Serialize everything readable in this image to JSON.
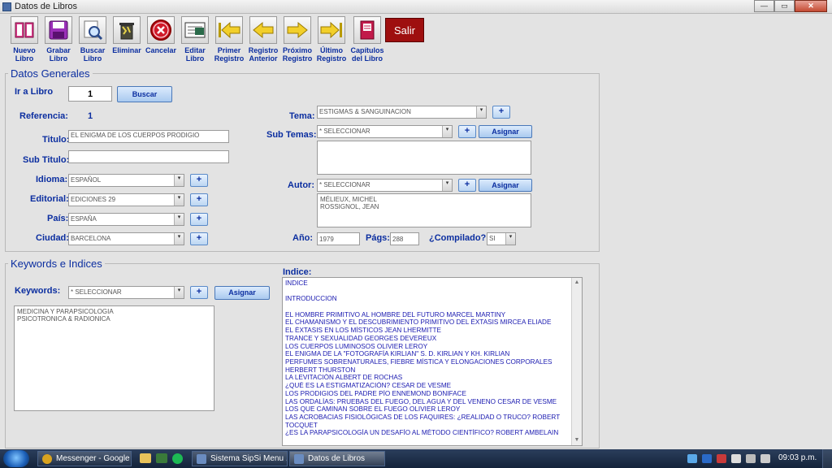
{
  "window": {
    "title": "Datos de Libros",
    "min": "—",
    "max": "▭",
    "close": "✕"
  },
  "toolbar": {
    "buttons": [
      {
        "label": "Nuevo\nLibro",
        "icon": "new-book-icon"
      },
      {
        "label": "Grabar\nLibro",
        "icon": "save-disk-icon"
      },
      {
        "label": "Buscar\nLibro",
        "icon": "search-magnifier-icon"
      },
      {
        "label": "Eliminar",
        "icon": "trash-icon"
      },
      {
        "label": "Cancelar",
        "icon": "cancel-x-icon"
      },
      {
        "label": "Editar\nLibro",
        "icon": "edit-book-icon"
      },
      {
        "label": "Primer\nRegistro",
        "icon": "first-record-arrow-icon"
      },
      {
        "label": "Registro\nAnterior",
        "icon": "previous-arrow-icon"
      },
      {
        "label": "Próximo\nRegistro",
        "icon": "next-arrow-icon"
      },
      {
        "label": "Último\nRegistro",
        "icon": "last-record-arrow-icon"
      },
      {
        "label": "Capítulos\ndel Libro",
        "icon": "chapters-book-icon"
      }
    ],
    "salir": "Salir"
  },
  "general": {
    "title": "Datos Generales",
    "ir_a_libro": "Ir a Libro",
    "ir_value": "1",
    "buscar": "Buscar",
    "referencia_label": "Referencia:",
    "referencia_value": "1",
    "titulo_label": "Titulo:",
    "titulo_value": "EL ENIGMA DE LOS CUERPOS PRODIGIO",
    "subtitulo_label": "Sub Titulo:",
    "subtitulo_value": "",
    "idioma_label": "Idioma:",
    "idioma_value": "ESPAÑOL",
    "editorial_label": "Editorial:",
    "editorial_value": "EDICIONES 29",
    "pais_label": "País:",
    "pais_value": "ESPAÑA",
    "ciudad_label": "Ciudad:",
    "ciudad_value": "BARCELONA",
    "tema_label": "Tema:",
    "tema_value": "ESTIGMAS & SANGUINACION",
    "subtemas_label": "Sub Temas:",
    "subtemas_value": "* SELECCIONAR",
    "autor_label": "Autor:",
    "autor_value": "* SELECCIONAR",
    "autores": [
      "MÉLIEUX, MICHEL",
      "ROSSIGNOL, JEAN"
    ],
    "asignar": "Asignar",
    "anio_label": "Año:",
    "anio_value": "1979",
    "pags_label": "Págs:",
    "pags_value": "288",
    "compilado_label": "¿Compilado?:",
    "compilado_value": "SI",
    "plus": "+"
  },
  "keywords": {
    "title": "Keywords e Indices",
    "label": "Keywords:",
    "select_value": "* SELECCIONAR",
    "asignar": "Asignar",
    "items": [
      "MEDICINA Y PARAPSICOLOGIA",
      "PSICOTRONICA & RADIONICA"
    ],
    "indice_label": "Indice:",
    "indice_lines": [
      "INDICE",
      "",
      "INTRODUCCION",
      "",
      "EL HOMBRE PRIMITIVO AL HOMBRE DEL FUTURO MARCEL MARTINY",
      "EL CHAMANISMO Y EL DESCUBRIMIENTO PRIMITIVO DEL ÉXTASIS MIRCEA ELIADE",
      "EL ÉXTASIS EN LOS MÍSTICOS JEAN LHERMITTE",
      "TRANCE Y SEXUALIDAD GEORGES DEVEREUX",
      "LOS CUERPOS LUMINOSOS OLIVIER LEROY",
      "EL ENIGMA DE LA \"FOTOGRAFÍA KIRLIAN\" S. D. KIRLIAN Y KH. KIRLIAN",
      "PERFUMES SOBRENATURALES, FIEBRE MÍSTICA Y ELONGACIONES CORPORALES",
      "HERBERT THURSTON",
      "LA LEVITACIÓN ALBERT DE ROCHAS",
      "¿QUÉ ES LA ESTIGMATIZACIÓN? CESAR DE VESME",
      "LOS PRODIGIOS DEL PADRE PÍO ENNEMOND BONIFACE",
      "LAS ORDALÍAS: PRUEBAS DEL FUEGO, DEL AGUA Y DEL VENENO CESAR DE VESME",
      "LOS QUE CAMINAN SOBRE EL FUEGO OLIVIER LEROY",
      "LAS ACROBACIAS FISIOLÓGICAS DE LOS FAQUIRES: ¿REALIDAD O TRUCO? ROBERT",
      "TOCQUET",
      "¿ES LA PARAPSICOLOGÍA UN DESAFÍO AL MÉTODO CIENTÍFICO? ROBERT AMBELAIN"
    ]
  },
  "taskbar": {
    "tasks": [
      {
        "label": "Messenger - Google ...",
        "color": "#d9a31f"
      },
      {
        "label": "Sistema SipSi Menu ...",
        "color": "#6a8cc0"
      },
      {
        "label": "Datos de Libros",
        "color": "#6a8cc0"
      }
    ],
    "time": "09:03 p.m."
  }
}
